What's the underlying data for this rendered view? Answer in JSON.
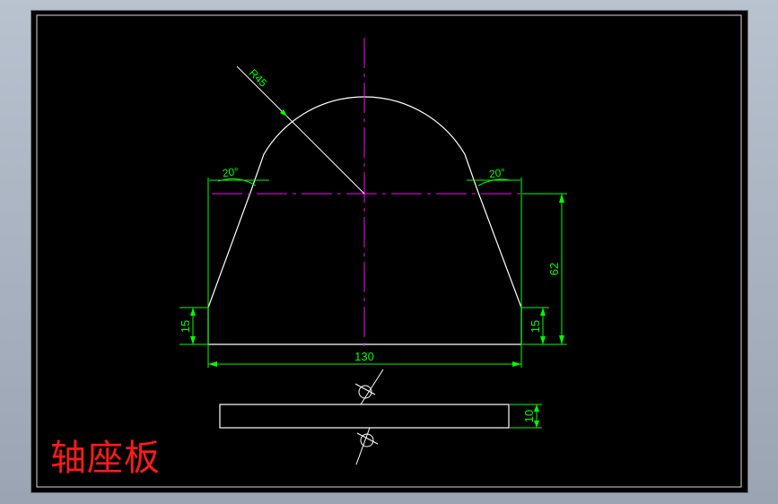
{
  "drawing": {
    "title": "轴座板",
    "labels": {
      "radius": "R45",
      "angle_left": "20°",
      "angle_right": "20°",
      "height_total": "62",
      "side_left": "15",
      "side_right": "15",
      "width_base": "130",
      "thickness": "10"
    },
    "colors": {
      "background": "#000000",
      "outline": "#ffffff",
      "centerline": "#ff00ff",
      "dimension": "#00ff00",
      "title": "#ff1a1a"
    }
  }
}
